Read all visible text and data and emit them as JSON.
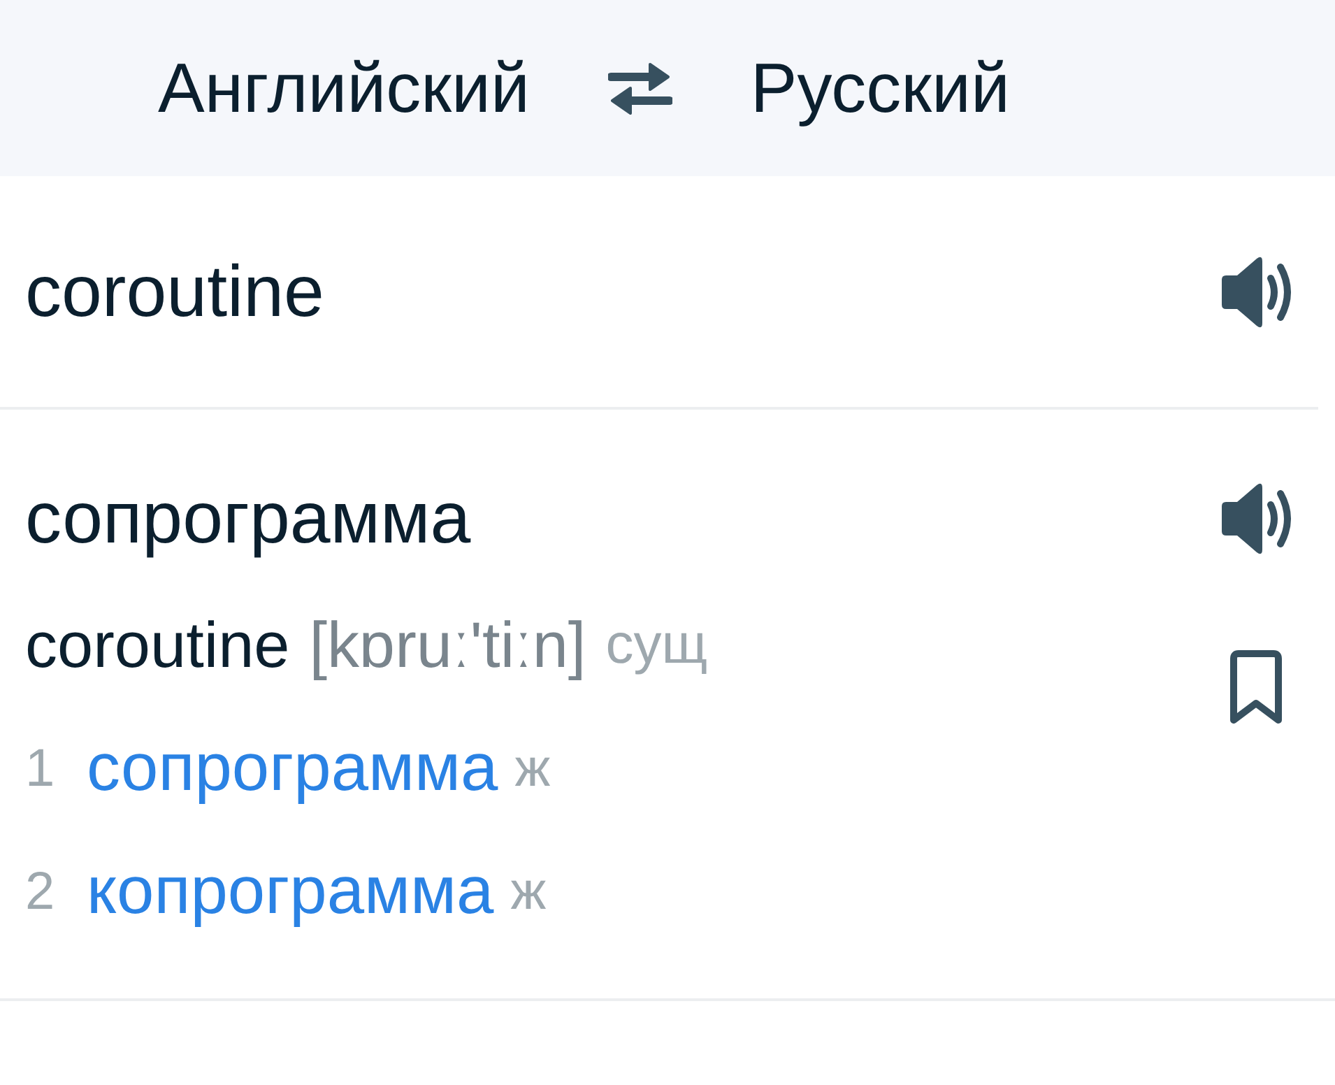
{
  "header": {
    "source_language": "Английский",
    "target_language": "Русский"
  },
  "source": {
    "text": "coroutine"
  },
  "translation": {
    "text": "сопрограмма",
    "bookmarked": false,
    "entry": {
      "headword": "coroutine",
      "transcription": "[kɒruː'tiːn]",
      "part_of_speech": "сущ"
    },
    "meanings": [
      {
        "number": "1",
        "word": "сопрограмма",
        "gender": "ж"
      },
      {
        "number": "2",
        "word": "копрограмма",
        "gender": "ж"
      }
    ]
  }
}
